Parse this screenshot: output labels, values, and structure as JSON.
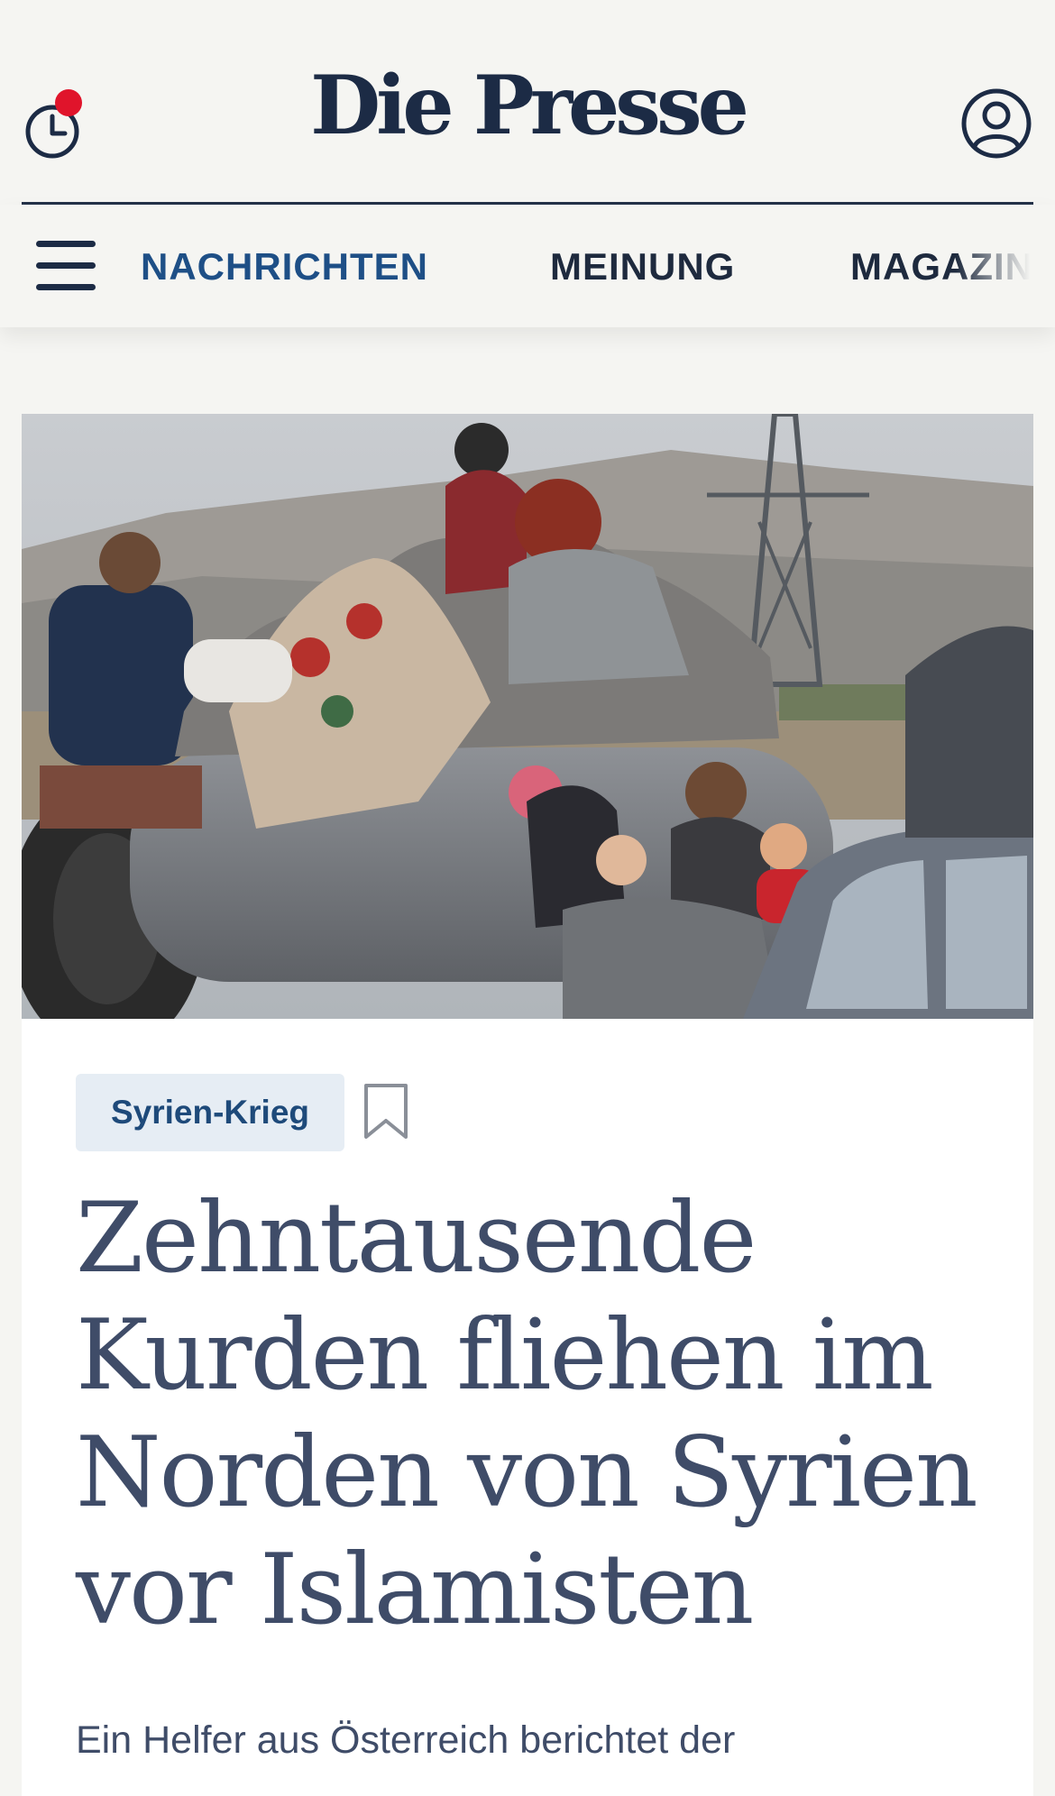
{
  "header": {
    "brand": "Die Presse",
    "history_icon": "clock-icon",
    "notification_color": "#e0142b",
    "account_icon": "user-circle-icon"
  },
  "nav": {
    "menu_icon": "hamburger-menu-icon",
    "items": [
      {
        "label": "NACHRICHTEN",
        "active": true
      },
      {
        "label": "MEINUNG",
        "active": false
      },
      {
        "label": "MAGAZIN",
        "active": false
      }
    ]
  },
  "article": {
    "image_description": "hero-photo",
    "tag": "Syrien-Krieg",
    "bookmark_icon": "bookmark-icon",
    "headline": "Zehntausende Kurden fliehen im Norden von Syrien vor Islamisten",
    "lead": "Ein Helfer aus Österreich berichtet der"
  },
  "colors": {
    "brand_navy": "#1c2b45",
    "nav_active": "#1e4f86",
    "headline": "#3f4c68",
    "tag_background": "#e6edf4"
  }
}
